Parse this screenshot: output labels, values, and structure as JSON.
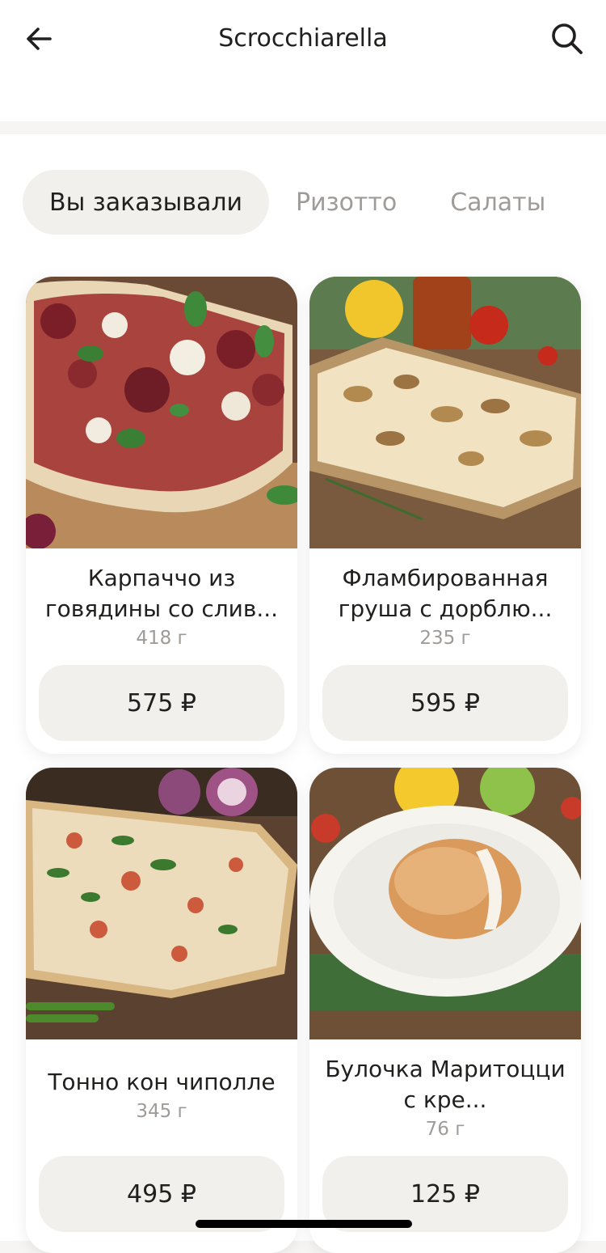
{
  "header": {
    "title": "Scrocchiarella",
    "back_icon": "arrow-left-icon",
    "search_icon": "search-icon"
  },
  "tabs": [
    {
      "label": "Вы заказывали",
      "active": true
    },
    {
      "label": "Ризотто",
      "active": false
    },
    {
      "label": "Салаты",
      "active": false
    }
  ],
  "products": [
    {
      "name": "Карпаччо из говядины со сливками",
      "name_display": "Карпаччо из говядины со слив...",
      "weight": "418 г",
      "price": "575 ₽",
      "image": "pizza-carpaccio"
    },
    {
      "name": "Фламбированная груша с дорблю",
      "name_display": "Фламбированная груша с дорблю...",
      "weight": "235 г",
      "price": "595 ₽",
      "image": "pizza-pear-dorblu"
    },
    {
      "name": "Тонно кон чиполле",
      "name_display": "Тонно кон чиполле",
      "weight": "345 г",
      "price": "495 ₽",
      "image": "pizza-tonno"
    },
    {
      "name": "Булочка Маритоцци с кремом",
      "name_display": "Булочка Маритоцци с кре...",
      "weight": "76 г",
      "price": "125 ₽",
      "image": "maritozzo-bun"
    }
  ],
  "colors": {
    "accent_bg": "#f1f0ed",
    "text_primary": "#21201f",
    "text_secondary": "#9e9b98"
  }
}
